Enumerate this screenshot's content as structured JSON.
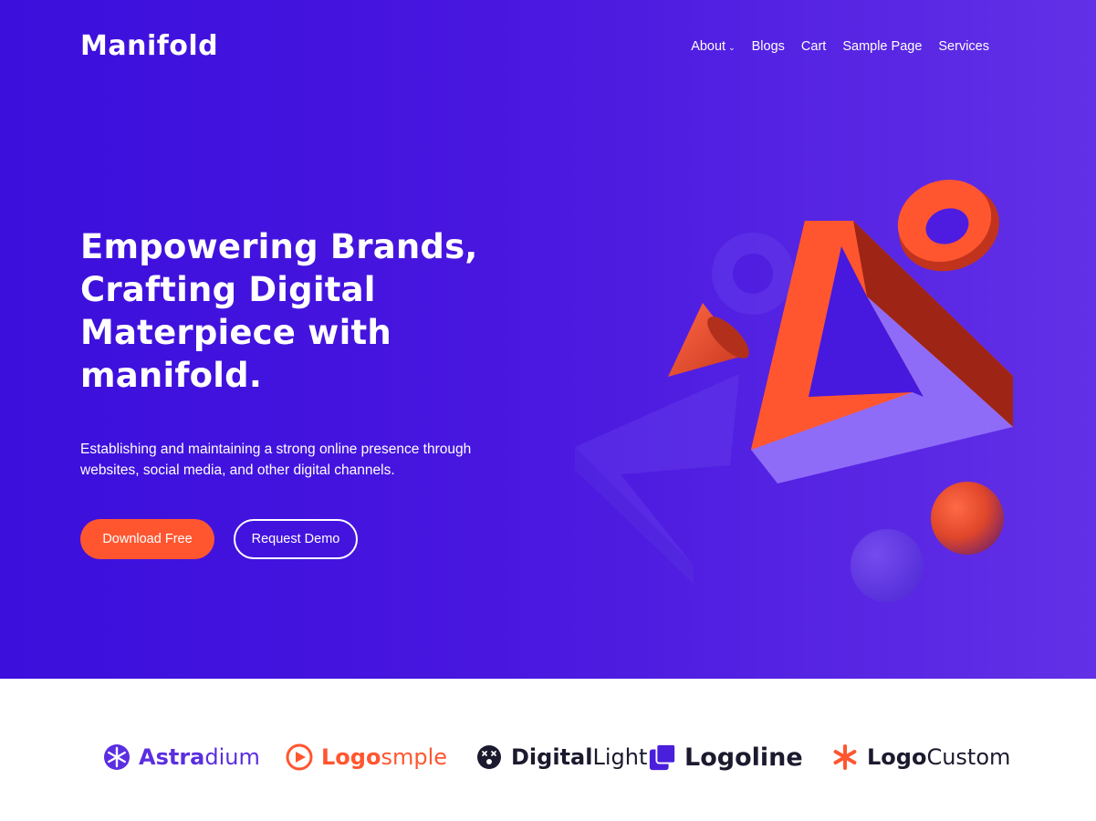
{
  "header": {
    "logo": "Manifold",
    "nav": [
      {
        "label": "About"
      },
      {
        "label": "Blogs"
      },
      {
        "label": "Cart"
      },
      {
        "label": "Sample Page"
      },
      {
        "label": "Services"
      }
    ]
  },
  "hero": {
    "headline": "Empowering Brands, Crafting Digital Materpiece with manifold.",
    "subtext": "Establishing and maintaining a strong online presence through websites, social media, and other digital channels.",
    "primary_button": "Download Free",
    "secondary_button": "Request Demo"
  },
  "brands": [
    {
      "bold": "Astra",
      "light": "dium",
      "icon": "snowflake-icon"
    },
    {
      "bold": "Logo",
      "light": "smple",
      "icon": "play-circle-icon"
    },
    {
      "bold": "Digital",
      "light": "Light",
      "icon": "face-icon"
    },
    {
      "bold": "Logoline",
      "light": "",
      "icon": "stacked-squares-icon"
    },
    {
      "bold": "Logo",
      "light": "Custom",
      "icon": "asterisk-icon"
    }
  ],
  "colors": {
    "hero_start": "#3c0fdc",
    "hero_end": "#6230e6",
    "accent": "#ff5630",
    "astradium": "#5b2ee0"
  }
}
